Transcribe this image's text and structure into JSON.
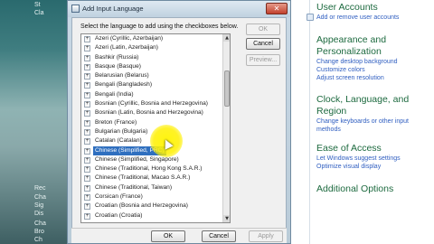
{
  "background_panel": {
    "text_top": [
      "St",
      "Cla"
    ],
    "text_bottom": [
      "Rec",
      "Cha",
      "Sig",
      "Dis",
      "Cha",
      "Bro",
      "Ch"
    ]
  },
  "dialog": {
    "title": "Add Input Language",
    "instruction": "Select the language to add using the checkboxes below.",
    "buttons": {
      "ok": "OK",
      "cancel": "Cancel",
      "preview": "Preview..."
    },
    "bottom_buttons": {
      "ok": "OK",
      "cancel": "Cancel",
      "apply": "Apply"
    },
    "languages": [
      "Azeri (Cyrillic, Azerbaijan)",
      "Azeri (Latin, Azerbaijan)",
      "Bashkir (Russia)",
      "Basque (Basque)",
      "Belarusian (Belarus)",
      "Bengali (Bangladesh)",
      "Bengali (India)",
      "Bosnian (Cyrillic, Bosnia and Herzegovina)",
      "Bosnian (Latin, Bosnia and Herzegovina)",
      "Breton (France)",
      "Bulgarian (Bulgaria)",
      "Catalan (Catalan)",
      "Chinese (Simplified, PRC)",
      "Chinese (Simplified, Singapore)",
      "Chinese (Traditional, Hong Kong S.A.R.)",
      "Chinese (Traditional, Macao S.A.R.)",
      "Chinese (Traditional, Taiwan)",
      "Corsican (France)",
      "Croatian (Bosnia and Herzegovina)",
      "Croatian (Croatia)"
    ],
    "selected_index": 12
  },
  "control_panel": {
    "sections": [
      {
        "heading": "User Accounts",
        "links": [
          "Add or remove user accounts"
        ]
      },
      {
        "heading": "Appearance and Personalization",
        "links": [
          "Change desktop background",
          "Customize colors",
          "Adjust screen resolution"
        ]
      },
      {
        "heading": "Clock, Language, and Region",
        "links": [
          "Change keyboards or other input methods"
        ]
      },
      {
        "heading": "Ease of Access",
        "links": [
          "Let Windows suggest settings",
          "Optimize visual display"
        ]
      },
      {
        "heading": "Additional Options",
        "links": []
      }
    ]
  }
}
